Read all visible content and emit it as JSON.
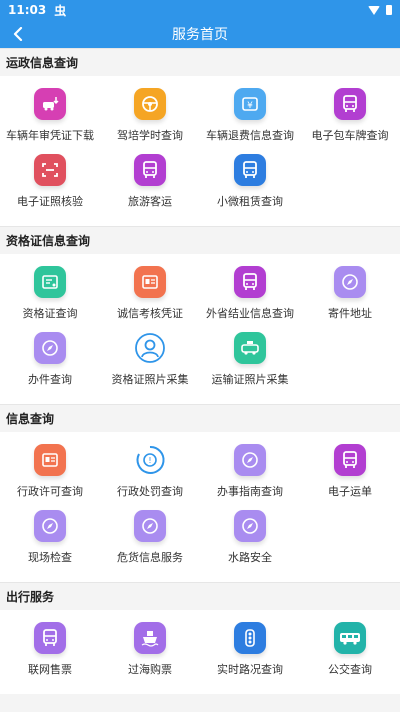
{
  "status": {
    "time": "11:03",
    "notif": "虫"
  },
  "nav": {
    "title": "服务首页"
  },
  "sections": [
    {
      "title": "运政信息查询",
      "items": [
        {
          "label": "车辆年审凭证下载",
          "icon": "car-download-icon",
          "color": "#d63fb3"
        },
        {
          "label": "驾培学时查询",
          "icon": "steering-wheel-icon",
          "color": "#f5a524"
        },
        {
          "label": "车辆退费信息查询",
          "icon": "refund-icon",
          "color": "#4ea9f0"
        },
        {
          "label": "电子包车牌查询",
          "icon": "bus-icon",
          "color": "#b23ed1"
        },
        {
          "label": "电子证照核验",
          "icon": "scan-icon",
          "color": "#e0505e"
        },
        {
          "label": "旅游客运",
          "icon": "bus-icon",
          "color": "#b23ed1"
        },
        {
          "label": "小微租赁查询",
          "icon": "bus-icon",
          "color": "#2d7de0"
        }
      ]
    },
    {
      "title": "资格证信息查询",
      "items": [
        {
          "label": "资格证查询",
          "icon": "certificate-icon",
          "color": "#2fc59b"
        },
        {
          "label": "诚信考核凭证",
          "icon": "credit-card-icon",
          "color": "#f2734f"
        },
        {
          "label": "外省结业信息查询",
          "icon": "bus-icon",
          "color": "#b23ed1"
        },
        {
          "label": "寄件地址",
          "icon": "compass-icon",
          "color": "#a98cf0"
        },
        {
          "label": "办件查询",
          "icon": "compass-icon",
          "color": "#a98cf0"
        },
        {
          "label": "资格证照片采集",
          "icon": "person-icon",
          "color": "#ffffff"
        },
        {
          "label": "运输证照片采集",
          "icon": "taxi-icon",
          "color": "#2fc59b"
        }
      ]
    },
    {
      "title": "信息查询",
      "items": [
        {
          "label": "行政许可查询",
          "icon": "license-icon",
          "color": "#f2734f"
        },
        {
          "label": "行政处罚查询",
          "icon": "penalty-icon",
          "color": "#ffffff"
        },
        {
          "label": "办事指南查询",
          "icon": "compass-icon",
          "color": "#a98cf0"
        },
        {
          "label": "电子运单",
          "icon": "bus-icon",
          "color": "#b23ed1"
        },
        {
          "label": "现场检查",
          "icon": "compass-icon",
          "color": "#a98cf0"
        },
        {
          "label": "危货信息服务",
          "icon": "compass-icon",
          "color": "#a98cf0"
        },
        {
          "label": "水路安全",
          "icon": "compass-icon",
          "color": "#a98cf0"
        }
      ]
    },
    {
      "title": "出行服务",
      "items": [
        {
          "label": "联网售票",
          "icon": "bus-icon",
          "color": "#a26ee8"
        },
        {
          "label": "过海购票",
          "icon": "ship-icon",
          "color": "#a26ee8"
        },
        {
          "label": "实时路况查询",
          "icon": "traffic-light-icon",
          "color": "#2d7de0"
        },
        {
          "label": "公交查询",
          "icon": "city-bus-icon",
          "color": "#22b3a9"
        }
      ]
    }
  ]
}
